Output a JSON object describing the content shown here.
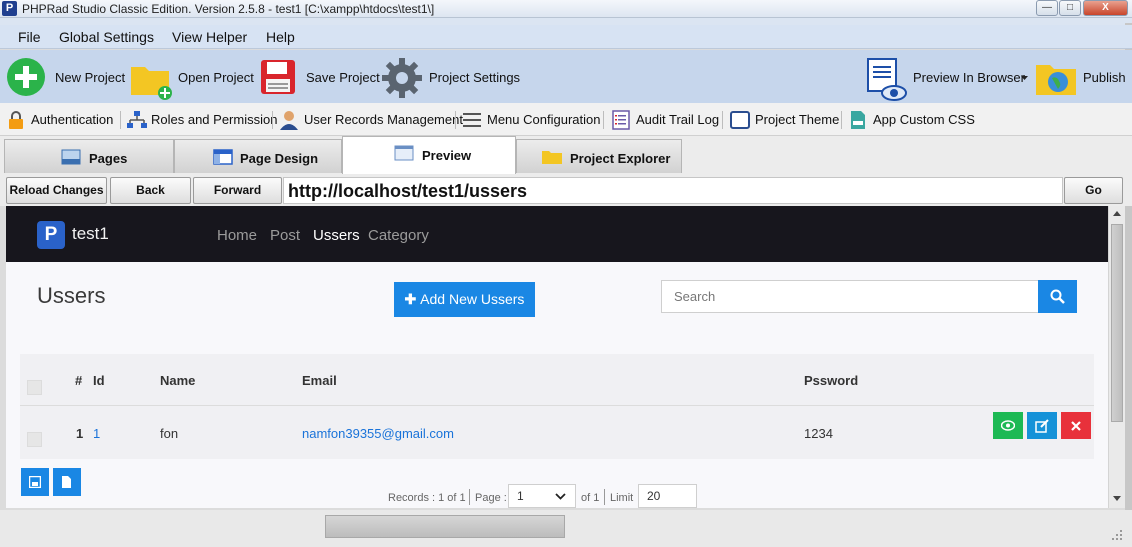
{
  "window": {
    "title": "PHPRad Studio Classic Edition.  Version 2.5.8 - test1 [C:\\xampp\\htdocs\\test1\\]",
    "app_icon_letter": "P",
    "controls": {
      "minimize": "—",
      "maximize": "□",
      "close": "X"
    }
  },
  "menu": {
    "items": [
      "File",
      "Global Settings",
      "View Helper",
      "Help"
    ]
  },
  "toolbar": {
    "new_project": "New Project",
    "open_project": "Open Project",
    "save_project": "Save Project",
    "project_settings": "Project Settings",
    "preview_in_browser": "Preview In Browser",
    "publish": "Publish"
  },
  "toolbar2": {
    "authentication": "Authentication",
    "roles": "Roles and Permission",
    "user_records": "User Records Management",
    "menu_config": "Menu Configuration",
    "audit_trail": "Audit Trail Log",
    "project_theme": "Project Theme",
    "app_css": "App Custom CSS"
  },
  "tabs": {
    "pages": "Pages",
    "page_design": "Page Design",
    "preview": "Preview",
    "project_explorer": "Project Explorer"
  },
  "navbar": {
    "reload": "Reload Changes",
    "back": "Back",
    "forward": "Forward",
    "url": "http://localhost/test1/ussers",
    "go": "Go"
  },
  "site": {
    "brand_logo": "P",
    "brand": "test1",
    "nav": [
      "Home",
      "Post",
      "Ussers",
      "Category"
    ],
    "page_title": "Ussers",
    "add_button": "Add New Ussers",
    "search_placeholder": "Search",
    "table": {
      "headers": {
        "num": "#",
        "id": "Id",
        "name": "Name",
        "email": "Email",
        "password": "Pssword"
      },
      "rows": [
        {
          "num": "1",
          "id": "1",
          "name": "fon",
          "email": "namfon39355@gmail.com",
          "password": "1234"
        }
      ]
    },
    "pager": {
      "records": "Records : 1 of 1",
      "page_label": "Page :",
      "page_value": "1",
      "of": "of 1",
      "limit_label": "Limit",
      "limit_value": "20"
    }
  },
  "colors": {
    "primary": "#1a87e4",
    "success": "#1db954",
    "info": "#1592d8",
    "danger": "#e8313b",
    "site_nav": "#17161d"
  }
}
